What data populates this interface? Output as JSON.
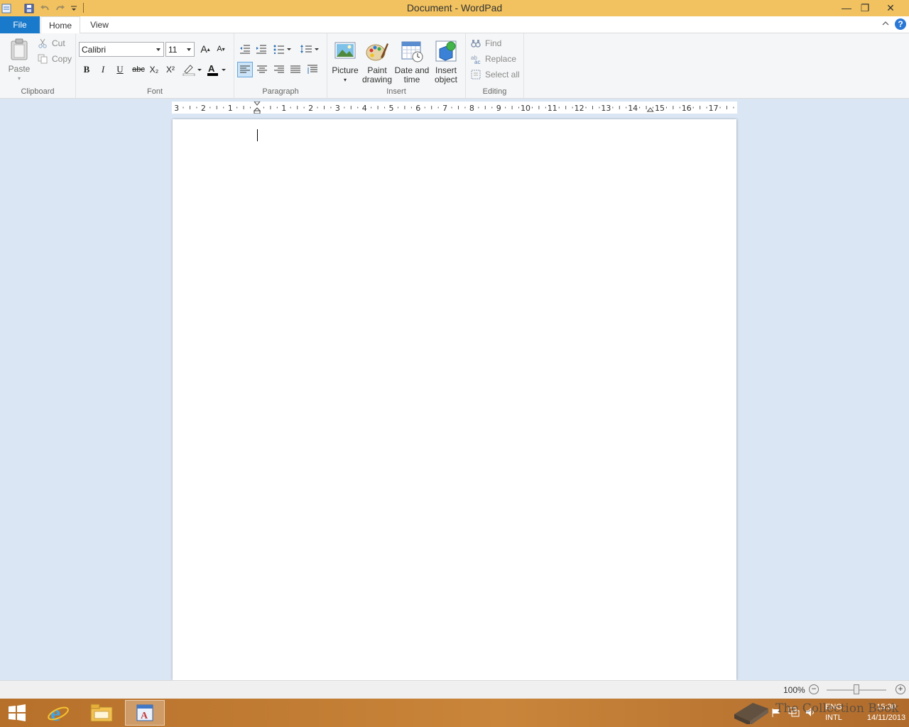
{
  "window": {
    "title": "Document - WordPad",
    "controls": {
      "minimize": "—",
      "restore": "❐",
      "close": "✕"
    }
  },
  "quick_access": {
    "icons": [
      "wordpad-app-icon",
      "save-icon",
      "undo-icon",
      "redo-icon",
      "customize-qat-icon"
    ]
  },
  "tabs": {
    "file": "File",
    "home": "Home",
    "view": "View",
    "help": "?"
  },
  "ribbon": {
    "clipboard": {
      "label": "Clipboard",
      "paste": "Paste",
      "cut": "Cut",
      "copy": "Copy"
    },
    "font": {
      "label": "Font",
      "family": "Calibri",
      "size": "11",
      "bold": "B",
      "italic": "I",
      "underline": "U",
      "strike": "abc",
      "subscript": "X₂",
      "superscript": "X²",
      "grow": "A",
      "shrink": "A",
      "text_color": "#000000",
      "highlight_color": "#ffffff"
    },
    "paragraph": {
      "label": "Paragraph",
      "alignment_selected": "left"
    },
    "insert": {
      "label": "Insert",
      "picture": "Picture",
      "paint_line1": "Paint",
      "paint_line2": "drawing",
      "datetime_line1": "Date and",
      "datetime_line2": "time",
      "object_line1": "Insert",
      "object_line2": "object"
    },
    "editing": {
      "label": "Editing",
      "find": "Find",
      "replace": "Replace",
      "select_all": "Select all"
    }
  },
  "ruler": {
    "left_labels": [
      "3",
      "2",
      "1"
    ],
    "right_labels": [
      "1",
      "2",
      "3",
      "4",
      "5",
      "6",
      "7",
      "8",
      "9",
      "10",
      "11",
      "12",
      "13",
      "14",
      "15",
      "16",
      "17"
    ]
  },
  "document": {
    "text": ""
  },
  "status": {
    "zoom": "100%",
    "zoom_out": "−",
    "zoom_in": "+"
  },
  "taskbar": {
    "items": [
      "start-icon",
      "internet-explorer-icon",
      "file-explorer-icon",
      "wordpad-taskbar-icon"
    ],
    "active": "wordpad",
    "tray": {
      "lang_top": "ENG",
      "lang_bottom": "INTL",
      "time": "15:30",
      "date": "14/11/2013"
    }
  },
  "watermark": {
    "text": "The Collection Book"
  }
}
